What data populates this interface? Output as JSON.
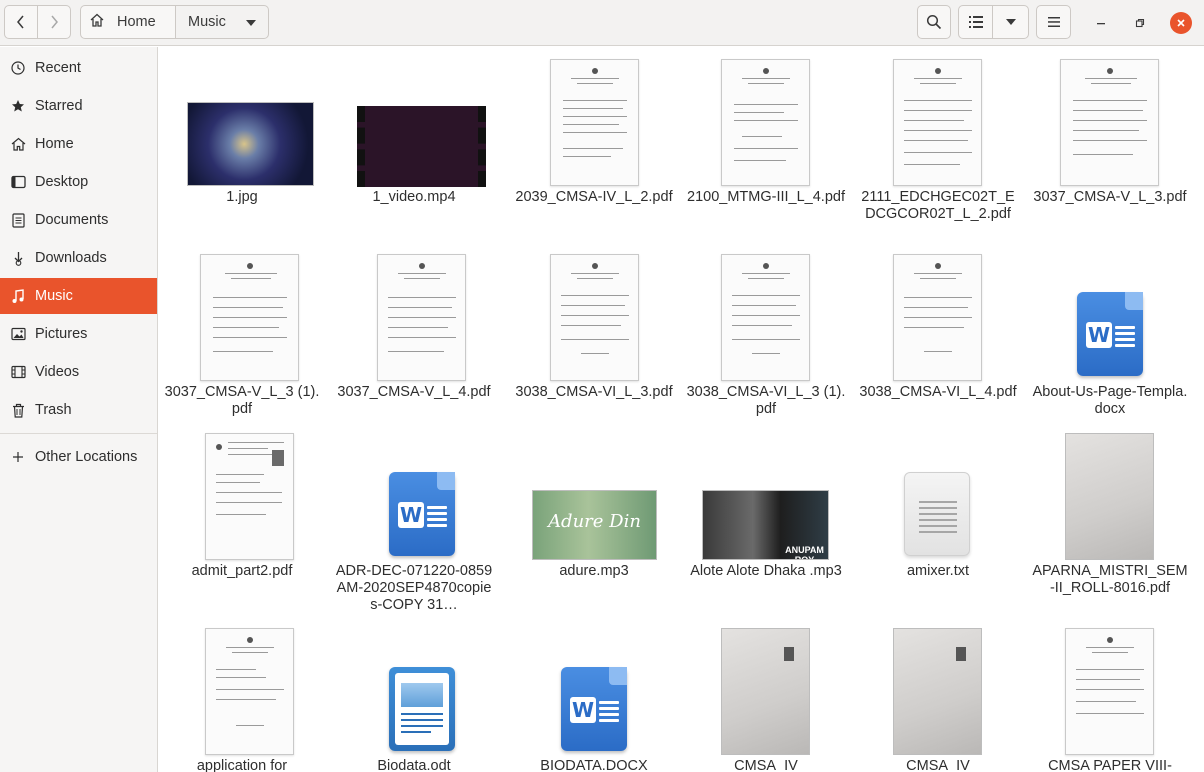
{
  "header": {
    "crumbs": [
      "Home",
      "Music"
    ]
  },
  "sidebar": {
    "items": [
      {
        "label": "Recent",
        "icon": "clock-icon"
      },
      {
        "label": "Starred",
        "icon": "star-icon"
      },
      {
        "label": "Home",
        "icon": "home-icon"
      },
      {
        "label": "Desktop",
        "icon": "desktop-icon"
      },
      {
        "label": "Documents",
        "icon": "documents-icon"
      },
      {
        "label": "Downloads",
        "icon": "downloads-icon"
      },
      {
        "label": "Music",
        "icon": "music-icon"
      },
      {
        "label": "Pictures",
        "icon": "pictures-icon"
      },
      {
        "label": "Videos",
        "icon": "videos-icon"
      },
      {
        "label": "Trash",
        "icon": "trash-icon"
      }
    ],
    "other_locations": "Other Locations",
    "active": "Music",
    "accent_color": "#e9542c"
  },
  "files": [
    {
      "name": "1.jpg",
      "kind": "image"
    },
    {
      "name": "1_video.mp4",
      "kind": "video"
    },
    {
      "name": "2039_CMSA-IV_L_2.pdf",
      "kind": "pdf"
    },
    {
      "name": "2100_MTMG-III_L_4.pdf",
      "kind": "pdf"
    },
    {
      "name": "2111_EDCHGEC02T_EDCGCOR02T_L_2.pdf",
      "kind": "pdf"
    },
    {
      "name": "3037_CMSA-V_L_3.pdf",
      "kind": "pdf"
    },
    {
      "name": "3037_CMSA-V_L_3 (1).pdf",
      "kind": "pdf"
    },
    {
      "name": "3037_CMSA-V_L_4.pdf",
      "kind": "pdf"
    },
    {
      "name": "3038_CMSA-VI_L_3.pdf",
      "kind": "pdf"
    },
    {
      "name": "3038_CMSA-VI_L_3 (1).pdf",
      "kind": "pdf"
    },
    {
      "name": "3038_CMSA-VI_L_4.pdf",
      "kind": "pdf"
    },
    {
      "name": "About-Us-Page-Templa.docx",
      "kind": "docx"
    },
    {
      "name": "admit_part2.pdf",
      "kind": "pdf"
    },
    {
      "name": "ADR-DEC-071220-0859AM-2020SEP4870copies-COPY 31…",
      "kind": "docx"
    },
    {
      "name": "adure.mp3",
      "kind": "audio",
      "art_text": "Adure Din"
    },
    {
      "name": "Alote Alote Dhaka .mp3",
      "kind": "audio",
      "art_text": "ANUPAM ROY"
    },
    {
      "name": "amixer.txt",
      "kind": "txt"
    },
    {
      "name": "APARNA_MISTRI_SEM-II_ROLL-8016.pdf",
      "kind": "scan"
    },
    {
      "name": "application for",
      "kind": "pdf"
    },
    {
      "name": "Biodata.odt",
      "kind": "odt"
    },
    {
      "name": "BIODATA.DOCX",
      "kind": "docx"
    },
    {
      "name": "CMSA_IV",
      "kind": "scan"
    },
    {
      "name": "CMSA_IV",
      "kind": "scan"
    },
    {
      "name": "CMSA PAPER VIII-",
      "kind": "pdf"
    }
  ]
}
